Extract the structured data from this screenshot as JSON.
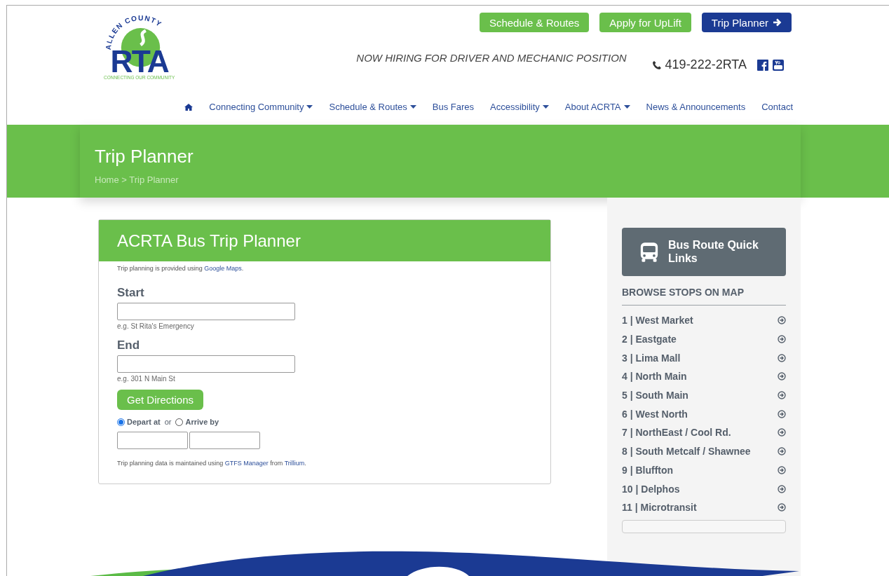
{
  "logo": {
    "arc_text": "ALLEN COUNTY",
    "letters": "RTA",
    "tagline": "CONNECTING OUR COMMUNITY"
  },
  "top_buttons": [
    {
      "label": "Schedule & Routes",
      "kind": "green"
    },
    {
      "label": "Apply for UpLift",
      "kind": "green"
    },
    {
      "label": "Trip Planner",
      "kind": "blue"
    }
  ],
  "announcement": "NOW HIRING FOR DRIVER AND MECHANIC POSITION",
  "phone": "419-222-2RTA",
  "nav": [
    {
      "label": "Connecting Community",
      "dropdown": true
    },
    {
      "label": "Schedule & Routes",
      "dropdown": true
    },
    {
      "label": "Bus Fares",
      "dropdown": false
    },
    {
      "label": "Accessibility",
      "dropdown": true
    },
    {
      "label": "About ACRTA",
      "dropdown": true
    },
    {
      "label": "News & Announcements",
      "dropdown": false
    },
    {
      "label": "Contact",
      "dropdown": false
    }
  ],
  "banner": {
    "title": "Trip Planner",
    "breadcrumb": {
      "items": [
        "Home",
        "Trip Planner"
      ],
      "separator": ">"
    }
  },
  "planner": {
    "title": "ACRTA Bus Trip Planner",
    "intro": {
      "text": "Trip planning is provided using ",
      "link": "Google Maps",
      "after": "."
    },
    "fields": [
      {
        "label": "Start",
        "hint": "e.g. St Rita's Emergency"
      },
      {
        "label": "End",
        "hint": "e.g. 301 N Main St"
      }
    ],
    "button": "Get Directions",
    "time_options": [
      {
        "label": "Depart at",
        "selected": true
      },
      {
        "label": "Arrive by",
        "selected": false
      }
    ],
    "or": "or",
    "footer": {
      "text": "Trip planning data is maintained using ",
      "link1": "GTFS Manager",
      "mid": " from ",
      "link2": "Trillium",
      "after": "."
    }
  },
  "sidebar": {
    "quick_links": "Bus Route Quick Links",
    "heading": "BROWSE STOPS ON MAP",
    "routes": [
      "1 | West Market",
      "2 | Eastgate",
      "3 | Lima Mall",
      "4 | North Main",
      "5 | South Main",
      "6 | West North",
      "7 | NorthEast / Cool Rd.",
      "8 | South Metcalf / Shawnee",
      "9 | Bluffton",
      "10 | Delphos",
      "11 | Microtransit"
    ]
  }
}
